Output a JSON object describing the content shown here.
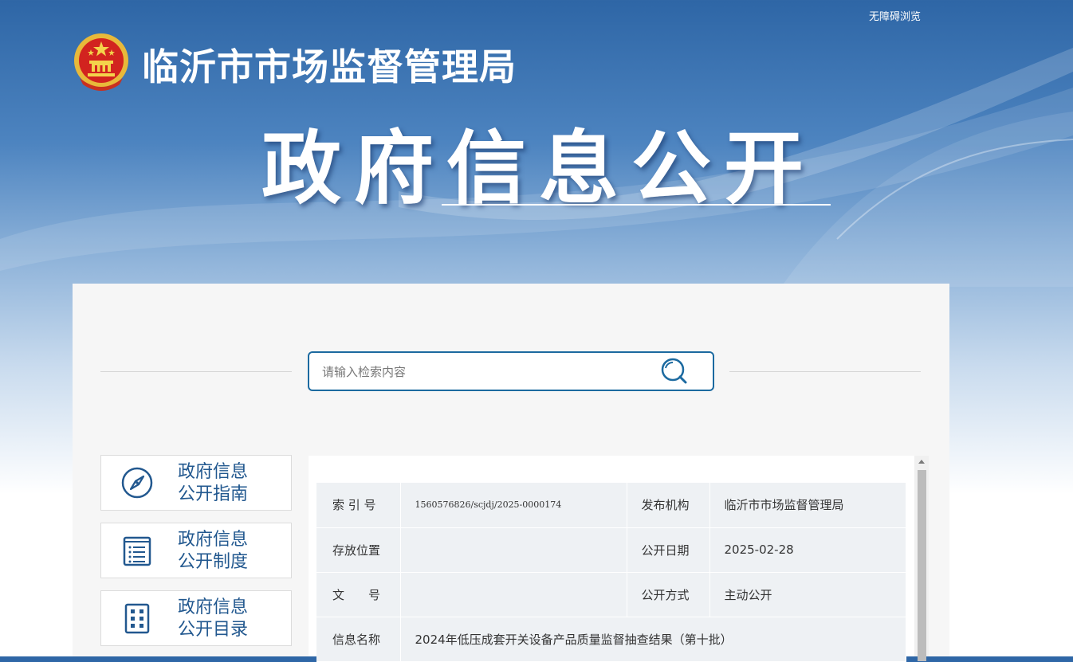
{
  "header": {
    "accessibility_link": "无障碍浏览",
    "site_name": "临沂市市场监督管理局",
    "banner_title": "政府信息公开"
  },
  "search": {
    "placeholder": "请输入检索内容"
  },
  "nav": [
    {
      "line1": "政府信息",
      "line2": "公开指南",
      "icon": "compass-icon"
    },
    {
      "line1": "政府信息",
      "line2": "公开制度",
      "icon": "list-document-icon"
    },
    {
      "line1": "政府信息",
      "line2": "公开目录",
      "icon": "catalog-grid-icon"
    }
  ],
  "info": {
    "index_label": "索 引 号",
    "index_value": "1560576826/scjdj/2025-0000174",
    "publisher_label": "发布机构",
    "publisher_value": "临沂市市场监督管理局",
    "location_label": "存放位置",
    "location_value": "",
    "date_label": "公开日期",
    "date_value": "2025-02-28",
    "docno_label": "文　　号",
    "docno_value": "",
    "mode_label": "公开方式",
    "mode_value": "主动公开",
    "name_label": "信息名称",
    "name_value": "2024年低压成套开关设备产品质量监督抽查结果（第十批）"
  },
  "colors": {
    "nav_text": "#22588f",
    "search_border": "#1c6aa0",
    "banner_top": "#2e66a6"
  }
}
